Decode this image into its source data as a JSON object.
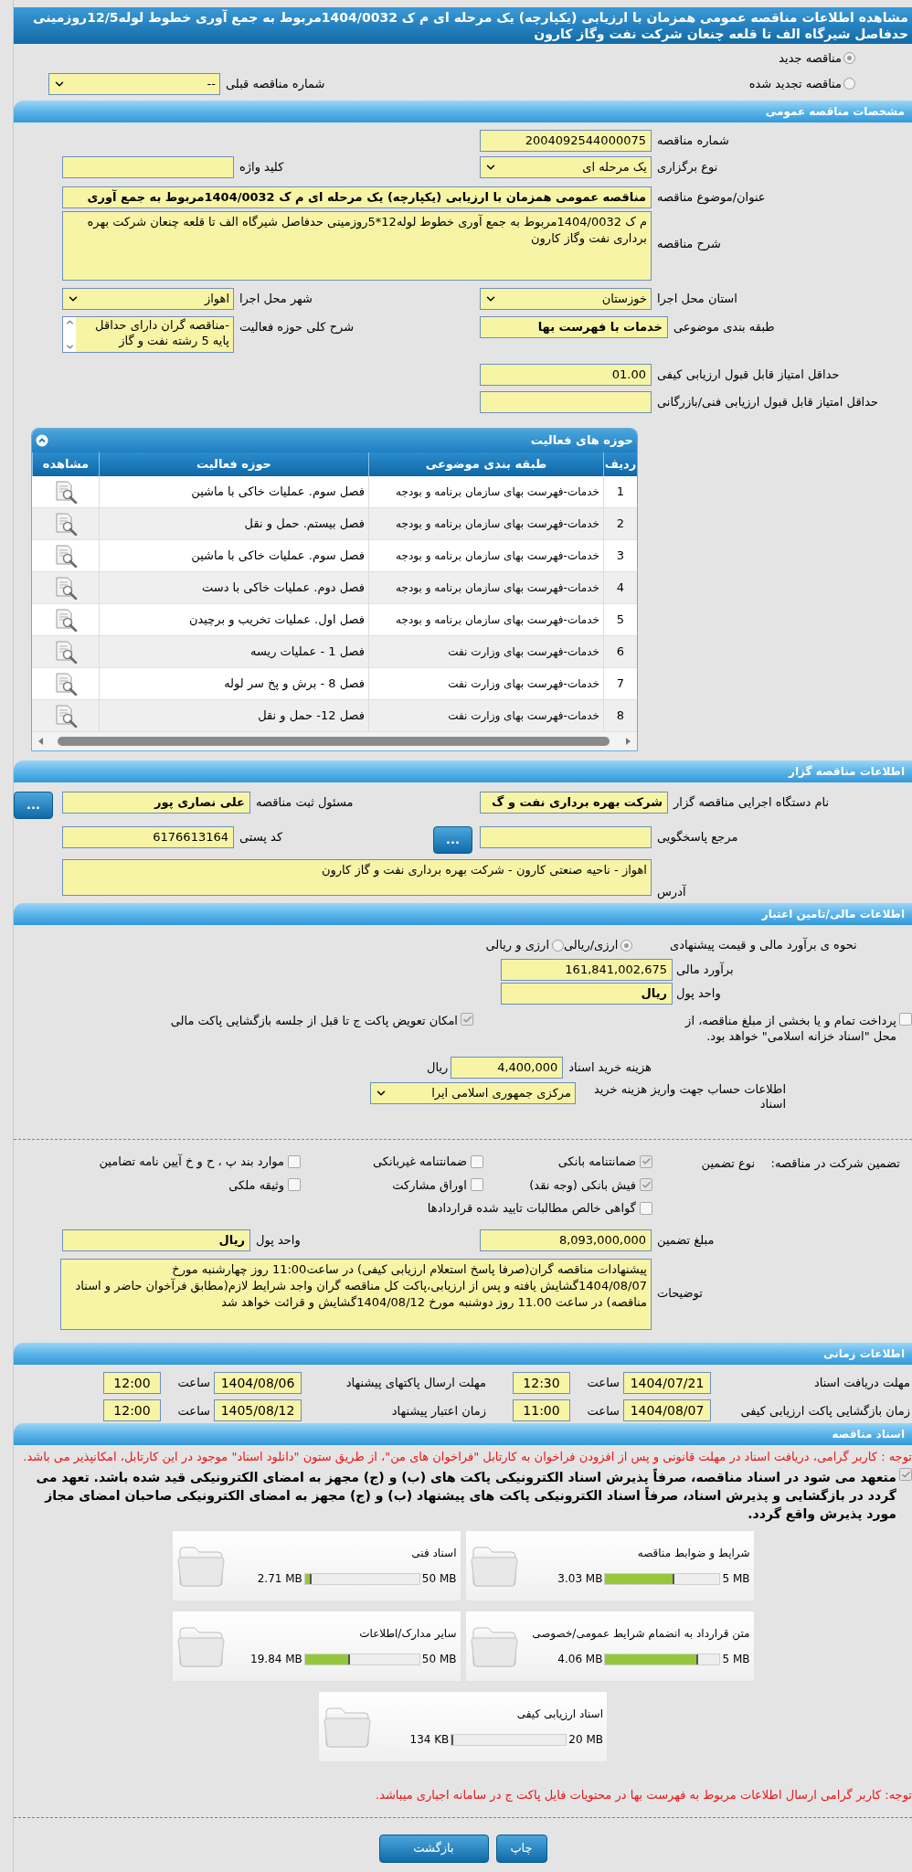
{
  "title": "مشاهده اطلاعات مناقصه عمومی همزمان با ارزیابی (یکپارچه) یک مرحله ای م ک 1404/0032مربوط به جمع آوری خطوط لوله12/5روزمینی حدفاصل شیرگاه الف تا قلعه چنعان شرکت نفت وگاز کارون",
  "tender_status": [
    {
      "label": "مناقصه جدید",
      "selected": true
    },
    {
      "label": "مناقصه تجدید شده",
      "selected": false
    }
  ],
  "previous_tender": {
    "label": "شماره مناقصه قبلی",
    "value": "--",
    "kind": "select"
  },
  "general": {
    "heading": "مشخصات مناقصه عمومی",
    "rows": [
      {
        "kind": "pair",
        "right": {
          "label": "شماره مناقصه",
          "value": "2004092544000075",
          "kind": "text"
        }
      },
      {
        "kind": "pair",
        "right": {
          "label": "نوع برگزاری",
          "value": "یک مرحله ای",
          "kind": "select"
        },
        "left": {
          "label": "کلید واژه",
          "kind": "text"
        }
      },
      {
        "kind": "wide",
        "field": {
          "label": "عنوان/موضوع مناقصه",
          "value": "مناقصه عمومی همزمان با ارزیابی (یکپارچه) یک مرحله ای م ک 1404/0032مربوط به جمع آوری",
          "kind": "text",
          "bold": true
        }
      },
      {
        "kind": "wide",
        "field": {
          "label": "شرح مناقصه",
          "value": "م ک 1404/0032مربوط به جمع آوری خطوط لوله12*5روزمینی حدفاصل شیرگاه الف تا قلعه چنعان شرکت بهره برداری نفت وگاز کارون",
          "kind": "textarea"
        }
      },
      {
        "kind": "pair",
        "right": {
          "label": "استان محل اجرا",
          "value": "خوزستان",
          "kind": "select"
        },
        "left": {
          "label": "شهر محل اجرا",
          "value": "اهواز",
          "kind": "select"
        }
      },
      {
        "kind": "pair",
        "right": {
          "label": "طبقه بندی موضوعی",
          "value": "خدمات با فهرست بها",
          "kind": "text",
          "bold": true
        },
        "left": {
          "label": "شرح کلی حوزه فعالیت",
          "value": "-مناقصه گران دارای حداقل پایه 5 رشته نفت و گاز",
          "kind": "listbox"
        }
      },
      {
        "kind": "pair",
        "right": {
          "label": "حداقل امتیاز قابل قبول ارزیابی کیفی",
          "value": "01.00",
          "kind": "text"
        }
      },
      {
        "kind": "pair",
        "right": {
          "label": "حداقل امتیاز قابل قبول ارزیابی فنی/بازرگانی",
          "kind": "text"
        }
      }
    ]
  },
  "activities": {
    "title": "حوزه های فعالیت",
    "columns": [
      "ردیف",
      "طبقه بندی موضوعی",
      "حوزه فعالیت",
      "مشاهده"
    ],
    "rows": [
      {
        "row": "1",
        "category": "خدمات-فهرست بهای سازمان برنامه و بودجه",
        "activity": "فصل سوم. عملیات خاکی با ماشین"
      },
      {
        "row": "2",
        "category": "خدمات-فهرست بهای سازمان برنامه و بودجه",
        "activity": "فصل بیستم. حمل و نقل"
      },
      {
        "row": "3",
        "category": "خدمات-فهرست بهای سازمان برنامه و بودجه",
        "activity": "فصل سوم. عملیات خاکی با ماشین"
      },
      {
        "row": "4",
        "category": "خدمات-فهرست بهای سازمان برنامه و بودجه",
        "activity": "فصل دوم. عملیات خاکی با دست"
      },
      {
        "row": "5",
        "category": "خدمات-فهرست بهای سازمان برنامه و بودجه",
        "activity": "فصل اول. عملیات تخریب و برچیدن"
      },
      {
        "row": "6",
        "category": "خدمات-فهرست بهای وزارت نفت",
        "activity": "فصل 1 - عملیات ریسه"
      },
      {
        "row": "7",
        "category": "خدمات-فهرست بهای وزارت نفت",
        "activity": "فصل 8 - برش و پخ سر لوله"
      },
      {
        "row": "8",
        "category": "خدمات-فهرست بهای وزارت نفت",
        "activity": "فصل 12- حمل و نقل"
      }
    ]
  },
  "organizer": {
    "heading": "اطلاعات مناقصه گزار",
    "rows": [
      {
        "kind": "pair",
        "right": {
          "label": "نام دستگاه اجرایی مناقصه گزار",
          "value": "شرکت بهره برداری نفت و گ",
          "kind": "text",
          "bold": true
        },
        "left": {
          "label": "مسئول ثبت مناقصه",
          "value": "علی  نصاری پور",
          "kind": "text",
          "bold": true,
          "button": "..."
        }
      },
      {
        "kind": "pair",
        "right": {
          "label": "مرجع پاسخگویی",
          "kind": "text",
          "button": "..."
        },
        "left": {
          "label": "کد پستی",
          "value": "6176613164",
          "kind": "text"
        }
      },
      {
        "kind": "wide",
        "field": {
          "label": "آدرس",
          "value": "اهواز - ناحیه صنعتی کارون - شرکت بهره برداری نفت و گاز کارون",
          "kind": "textarea"
        }
      }
    ]
  },
  "financial": {
    "heading": "اطلاعات مالی/تامین اعتبار",
    "estimate_method": {
      "label": "نحوه ی برآورد مالی و قیمت پیشنهادی",
      "options": [
        {
          "label": "ارزی/ریالی",
          "selected": true
        },
        {
          "label": "ارزی و ریالی",
          "selected": false
        }
      ]
    },
    "estimate": {
      "label": "برآورد مالی",
      "value": "161,841,002,675"
    },
    "currency": {
      "label": "واحد پول",
      "value": "ریال",
      "bold": true
    },
    "options": [
      {
        "label": "پرداخت تمام و یا بخشی از مبلغ مناقصه، از محل \"اسناد خزانه اسلامی\" خواهد بود.",
        "checked": false
      },
      {
        "label": "امکان تعویض پاکت ج تا قبل از جلسه بازگشایی پاکت مالی",
        "checked": true
      }
    ],
    "document_fee": {
      "label": "هزینه خرید اسناد",
      "value": "4,400,000",
      "unit": "ریال"
    },
    "account": {
      "label": "اطلاعات حساب جهت واریز هزینه خرید اسناد",
      "value": "مرکزی جمهوری اسلامی ایرا"
    }
  },
  "guarantee": {
    "label": "تضمین شرکت در مناقصه:",
    "type_label": "نوع تضمین",
    "types": [
      {
        "label": "ضمانتنامه بانکی",
        "checked": true
      },
      {
        "label": "ضمانتنامه غیربانکی",
        "checked": false
      },
      {
        "label": "موارد بند پ ، ح و خ آیین نامه تضامین",
        "checked": false
      },
      {
        "label": "فیش بانکی (وجه نقد)",
        "checked": true
      },
      {
        "label": "اوراق مشارکت",
        "checked": false
      },
      {
        "label": "وثیقه ملکی",
        "checked": false
      },
      {
        "label": "گواهی خالص مطالبات تایید شده قراردادها",
        "checked": false
      }
    ],
    "amount": {
      "label": "مبلغ تضمین",
      "value": "8,093,000,000",
      "kind": "text"
    },
    "currency": {
      "label": "واحد پول",
      "value": "ریال",
      "kind": "text",
      "bold": true
    },
    "notes": {
      "label": "توضیحات",
      "value": "پیشنهادات مناقصه گران(صرفا پاسخ استعلام ارزیابی کیفی) در ساعت11:00 روز چهارشنبه مورخ 1404/08/07گشایش یافته و پس از ارزیابی،پاکت کل مناقصه گران  واجد شرایط لازم(مطابق فرآخوان حاضر و اسناد مناقصه) در ساعت 11.00 روز  دوشنبه مورخ 1404/08/12گشایش و قرائت خواهد شد",
      "kind": "textarea"
    }
  },
  "timing": {
    "heading": "اطلاعات زمانی",
    "items": [
      {
        "label": "مهلت دریافت اسناد",
        "date": "1404/07/21",
        "time_label": "ساعت",
        "time": "12:30"
      },
      {
        "label": "مهلت ارسال پاکتهای پیشنهاد",
        "date": "1404/08/06",
        "time_label": "ساعت",
        "time": "12:00"
      },
      {
        "label": "زمان بازگشایی پاکت ارزیابی کیفی",
        "date": "1404/08/07",
        "time_label": "ساعت",
        "time": "11:00"
      },
      {
        "label": "زمان اعتبار پیشنهاد",
        "date": "1405/08/12",
        "time_label": "ساعت",
        "time": "12:00"
      }
    ]
  },
  "documents": {
    "heading": "اسناد مناقصه",
    "notice": "توجه : کاربر گرامی، دریافت اسناد در مهلت قانونی و پس از افزودن فراخوان به کارتابل \"فراخوان های من\"، از طریق ستون \"دانلود اسناد\" موجود در این کارتابل، امکانپذیر می باشد.",
    "commitment": {
      "label": "متعهد می شود در اسناد مناقصه، صرفاً پذیرش اسناد الکترونیکی پاکت های (ب) و (ج) مجهز به امضای الکترونیکی قید شده باشد. تعهد می گردد در بازگشایی و پذیرش اسناد، صرفاً اسناد الکترونیکی پاکت های پیشنهاد (ب) و (ج) مجهز به امضای الکترونیکی صاحبان امضای مجاز مورد پذیرش واقع گردد.",
      "checked": true
    },
    "files": [
      {
        "title": "شرایط و ضوابط مناقصه",
        "size": "3.03 MB",
        "limit": "5 MB",
        "level": 0.606
      },
      {
        "title": "اسناد فنی",
        "size": "2.71 MB",
        "limit": "50 MB",
        "level": 0.054
      },
      {
        "title": "متن قرارداد به انضمام شرایط عمومی/خصوصی",
        "size": "4.06 MB",
        "limit": "5 MB",
        "level": 0.812
      },
      {
        "title": "سایر مدارک/اطلاعات",
        "size": "19.84 MB",
        "limit": "50 MB",
        "level": 0.397
      },
      {
        "title": "اسناد ارزیابی کیفی",
        "size": "134 KB",
        "limit": "20 MB",
        "level": 0.0065
      }
    ],
    "footer_notice": "توجه: کاربر گرامی ارسال اطلاعات مربوط به فهرست بها در محتویات فایل پاکت ج در سامانه اجباری میباشد."
  },
  "actions": [
    "چاپ",
    "بازگشت"
  ]
}
